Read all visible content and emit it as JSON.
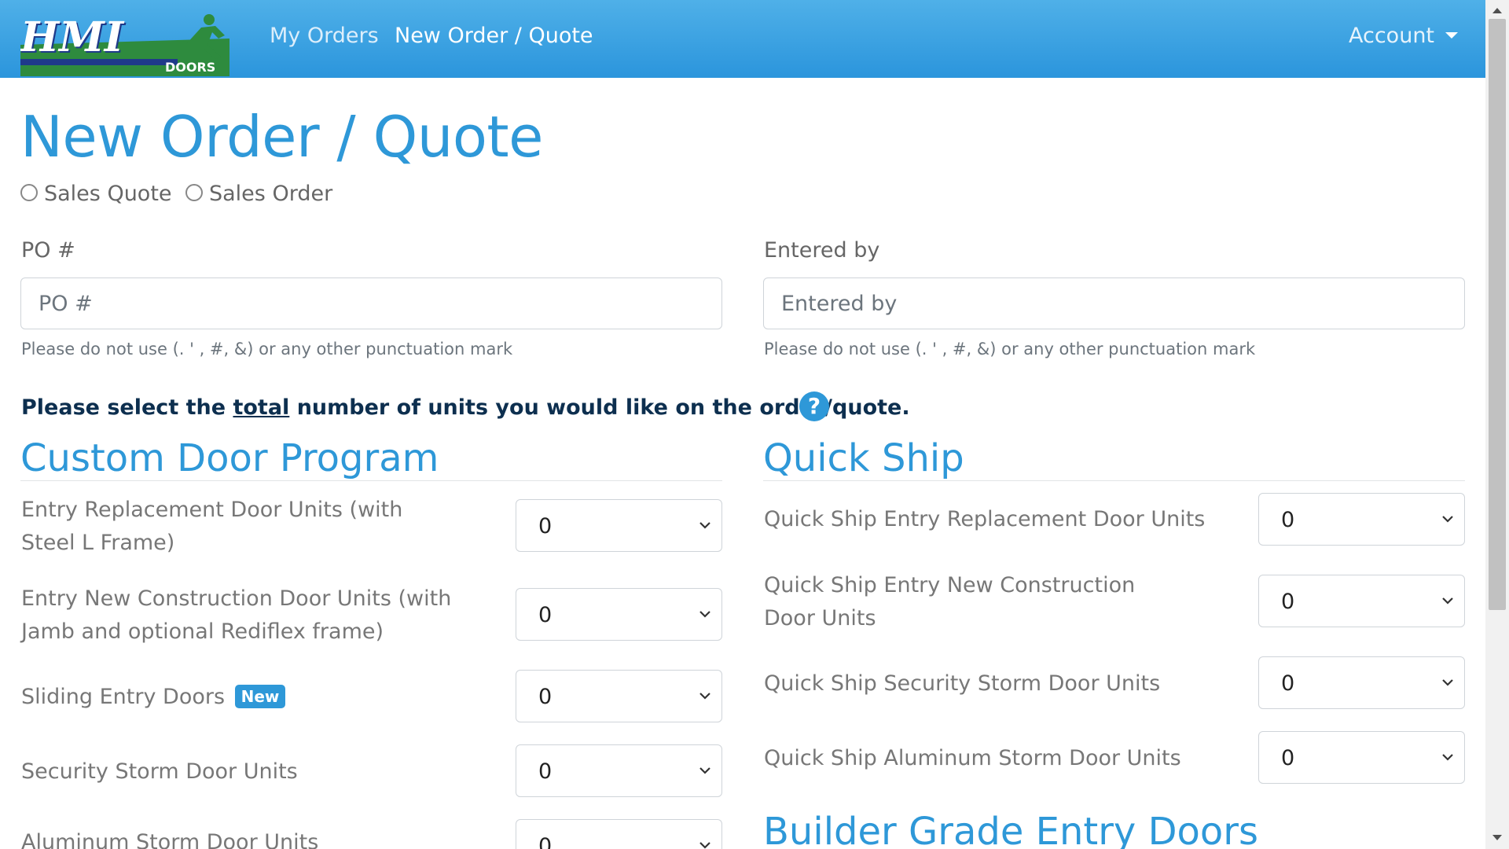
{
  "nav": {
    "brand_text": "HMI",
    "brand_sub": "DOORS",
    "links": [
      "My Orders",
      "New Order / Quote"
    ],
    "account": "Account",
    "colors": {
      "bar": "#2b95dc",
      "logo_green": "#2e8b3e",
      "logo_navy": "#1f3a8a"
    }
  },
  "page": {
    "title": "New Order / Quote",
    "radios": [
      "Sales Quote",
      "Sales Order"
    ]
  },
  "fields": {
    "po": {
      "label": "PO #",
      "placeholder": "PO #",
      "value": ""
    },
    "entered_by": {
      "label": "Entered by",
      "placeholder": "Entered by",
      "value": ""
    },
    "help": "Please do not use (. ' , #, &) or any other punctuation mark"
  },
  "instructions": {
    "before": "Please select the ",
    "emphasis": "total",
    "after": " number of units you would like on the order/quote.",
    "icon": "question-circle-icon"
  },
  "custom": {
    "title": "Custom Door Program",
    "rows": [
      {
        "label": "Entry Replacement Door Units (with Steel L Frame)",
        "value": "0"
      },
      {
        "label": "Entry New Construction Door Units (with Jamb and optional Rediflex frame)",
        "value": "0"
      },
      {
        "label": "Sliding Entry Doors",
        "badge": "New",
        "value": "0"
      },
      {
        "label": "Security Storm Door Units",
        "value": "0"
      },
      {
        "label": "Aluminum Storm Door Units",
        "value": "0"
      }
    ]
  },
  "quick": {
    "title": "Quick Ship",
    "rows": [
      {
        "label": "Quick Ship Entry Replacement Door Units",
        "value": "0"
      },
      {
        "label": "Quick Ship Entry New Construction Door Units",
        "value": "0"
      },
      {
        "label": "Quick Ship Security Storm Door Units",
        "value": "0"
      },
      {
        "label": "Quick Ship Aluminum Storm Door Units",
        "value": "0"
      }
    ]
  },
  "builder": {
    "title": "Builder Grade Entry Doors"
  }
}
